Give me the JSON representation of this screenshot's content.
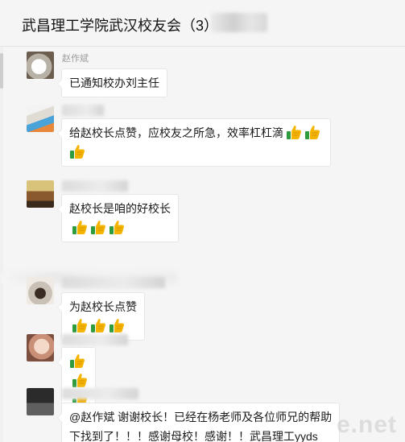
{
  "window": {
    "title": "武昌理工学院武汉校友会（3）"
  },
  "colors": {
    "background": "#f5f5f5",
    "bubble": "#ffffff",
    "sender_text": "#9a9a9a",
    "thumb_yellow": "#f4b400",
    "thumb_green": "#2e9b3c"
  },
  "messages": [
    {
      "sender": "赵作斌",
      "text": "已通知校办刘主任",
      "thumbs_after": 0,
      "thumbs_line2": 0,
      "line2": ""
    },
    {
      "sender": "",
      "text": "给赵校长点赞，应校友之所急，效率杠杠滴",
      "thumbs_after": 2,
      "thumbs_line2": 1,
      "line2": ""
    },
    {
      "sender": "",
      "text": "赵校长是咱的好校长",
      "thumbs_after": 3,
      "thumbs_line2": 0,
      "line2": ""
    },
    {
      "sender": "",
      "text": "为赵校长点赞",
      "thumbs_after": 3,
      "thumbs_line2": 0,
      "line2": ""
    },
    {
      "sender": "",
      "text": "",
      "thumbs_after": 3,
      "thumbs_line2": 0,
      "line2": ""
    },
    {
      "sender": "",
      "text": "@赵作斌 谢谢校长！已经在杨老师及各位师兄的帮助",
      "thumbs_after": 0,
      "thumbs_line2": 0,
      "line2": "下找到了！！！感谢母校！感谢！！武昌理工yyds"
    }
  ],
  "icons": {
    "thumbs_up": "thumbs-up-emoji-icon"
  },
  "watermark": "e.net"
}
